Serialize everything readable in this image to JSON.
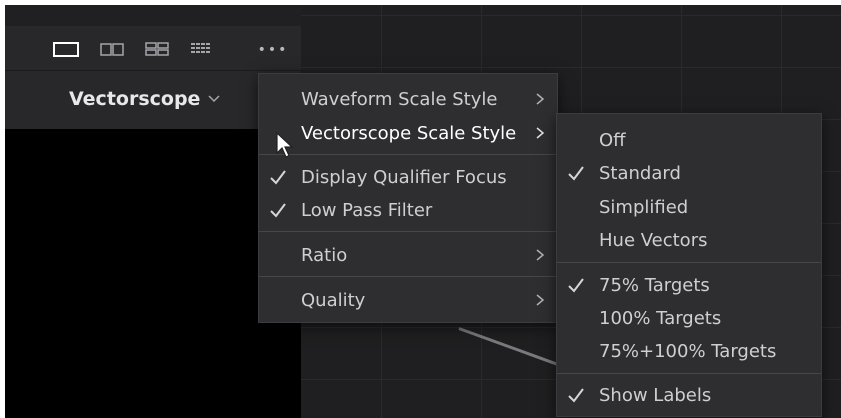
{
  "toolbar": {
    "view_buttons": [
      "single-view-icon",
      "dual-view-icon",
      "quad-view-icon",
      "grid-view-icon"
    ],
    "more_label": "•••"
  },
  "scope": {
    "title": "Vectorscope",
    "chevron": "chevron-down-icon"
  },
  "menu": {
    "items": [
      {
        "label": "Waveform Scale Style"
      },
      {
        "label": "Vectorscope Scale Style"
      },
      {
        "label": "Display Qualifier Focus"
      },
      {
        "label": "Low Pass Filter"
      },
      {
        "label": "Ratio"
      },
      {
        "label": "Quality"
      }
    ]
  },
  "submenu": {
    "items": [
      {
        "label": "Off"
      },
      {
        "label": "Standard"
      },
      {
        "label": "Simplified"
      },
      {
        "label": "Hue Vectors"
      },
      {
        "label": "75% Targets"
      },
      {
        "label": "100% Targets"
      },
      {
        "label": "75%+100% Targets"
      },
      {
        "label": "Show Labels"
      }
    ]
  },
  "colors": {
    "background": "#202022",
    "panel": "#28282b",
    "menu": "#2e2e31",
    "text": "#cfcfd2",
    "highlight_text": "#ffffff"
  }
}
